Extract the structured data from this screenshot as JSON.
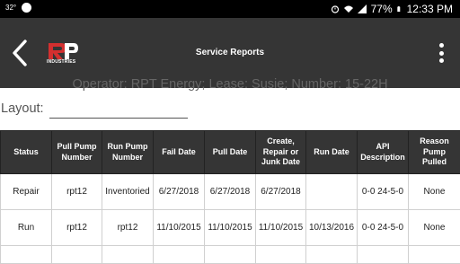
{
  "status_bar": {
    "temperature": "32°",
    "battery": "77%",
    "time": "12:33 PM"
  },
  "app_bar": {
    "title": "Service Reports",
    "logo_text": "RP",
    "logo_subtext": "INDUSTRIES"
  },
  "header": {
    "operator_line": "Operator: RPT Energy; Lease: Susie; Number: 15-22H",
    "layout_label": "Layout:",
    "layout_value": ""
  },
  "table": {
    "columns": [
      "Status",
      "Pull Pump Number",
      "Run Pump Number",
      "Fail Date",
      "Pull Date",
      "Create, Repair or Junk Date",
      "Run Date",
      "API Description",
      "Reason Pump Pulled"
    ],
    "rows": [
      [
        "Repair",
        "rpt12",
        "Inventoried",
        "6/27/2018",
        "6/27/2018",
        "6/27/2018",
        "",
        "0-0  24-5-0",
        "None"
      ],
      [
        "Run",
        "rpt12",
        "rpt12",
        "11/10/2015",
        "11/10/2015",
        "11/10/2015",
        "10/13/2016",
        "0-0  24-5-0",
        "None"
      ]
    ]
  },
  "colors": {
    "app_bar": "#353535",
    "status_bar": "#000000",
    "logo_red": "#d32f2f"
  }
}
